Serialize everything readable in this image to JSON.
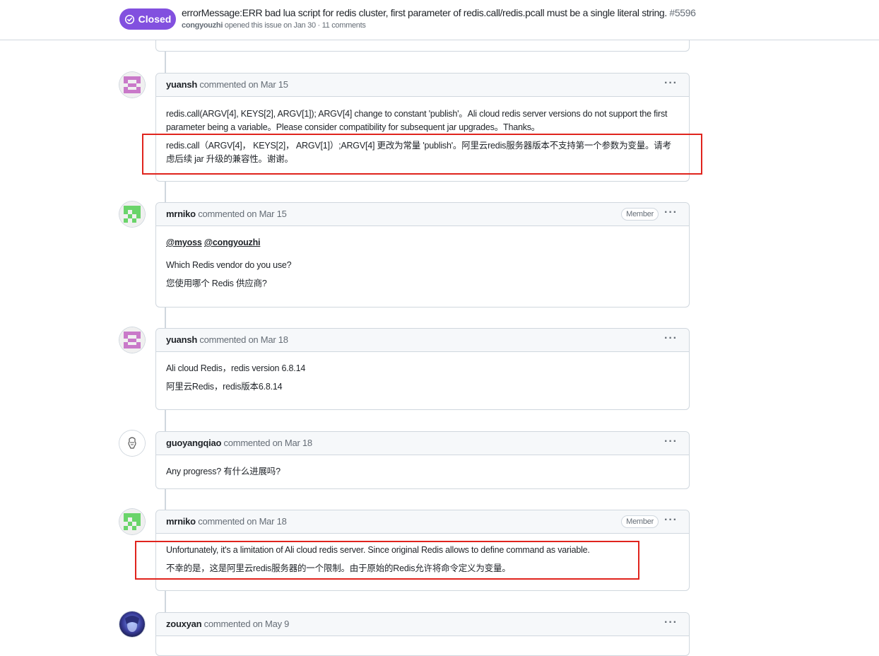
{
  "header": {
    "state": "Closed",
    "title": "errorMessage:ERR bad lua script for redis cluster, first parameter of redis.call/redis.pcall must be a single literal string.",
    "number": "#5596",
    "opener": "congyouzhi",
    "meta_suffix": "opened this issue on Jan 30 · 11 comments"
  },
  "comments": [
    {
      "author": "yuansh",
      "action": "commented",
      "date": "on Mar 15",
      "paragraphs": [
        "redis.call(ARGV[4], KEYS[2], ARGV[1]); ARGV[4] change to constant 'publish'。Ali cloud redis server versions do not support the first parameter being a variable。Please consider compatibility for subsequent jar upgrades。Thanks。",
        "redis.call（ARGV[4]， KEYS[2]， ARGV[1]）;ARGV[4] 更改为常量 'publish'。阿里云redis服务器版本不支持第一个参数为变量。请考虑后续 jar 升级的兼容性。谢谢。"
      ]
    },
    {
      "author": "mrniko",
      "action": "commented",
      "date": "on Mar 15",
      "badge": "Member",
      "mentions": [
        "@myoss",
        "@congyouzhi"
      ],
      "paragraphs": [
        "Which Redis vendor do you use?",
        "您使用哪个 Redis 供应商?"
      ]
    },
    {
      "author": "yuansh",
      "action": "commented",
      "date": "on Mar 18",
      "paragraphs": [
        "Ali cloud Redis，redis version 6.8.14",
        "阿里云Redis，redis版本6.8.14"
      ]
    },
    {
      "author": "guoyangqiao",
      "action": "commented",
      "date": "on Mar 18",
      "paragraphs": [
        "Any progress? 有什么进展吗?"
      ]
    },
    {
      "author": "mrniko",
      "action": "commented",
      "date": "on Mar 18",
      "badge": "Member",
      "paragraphs": [
        "Unfortunately, it's a limitation of Ali cloud redis server. Since original Redis allows to define command as variable.",
        "不幸的是，这是阿里云redis服务器的一个限制。由于原始的Redis允许将命令定义为变量。"
      ]
    },
    {
      "author": "zouxyan",
      "action": "commented",
      "date": "on May 9",
      "paragraphs": []
    }
  ],
  "icons": {
    "state": "issue-closed-icon",
    "menu": "kebab-horizontal-icon"
  },
  "colors": {
    "closed_badge": "#8250df",
    "highlight_box": "#e0241d"
  }
}
